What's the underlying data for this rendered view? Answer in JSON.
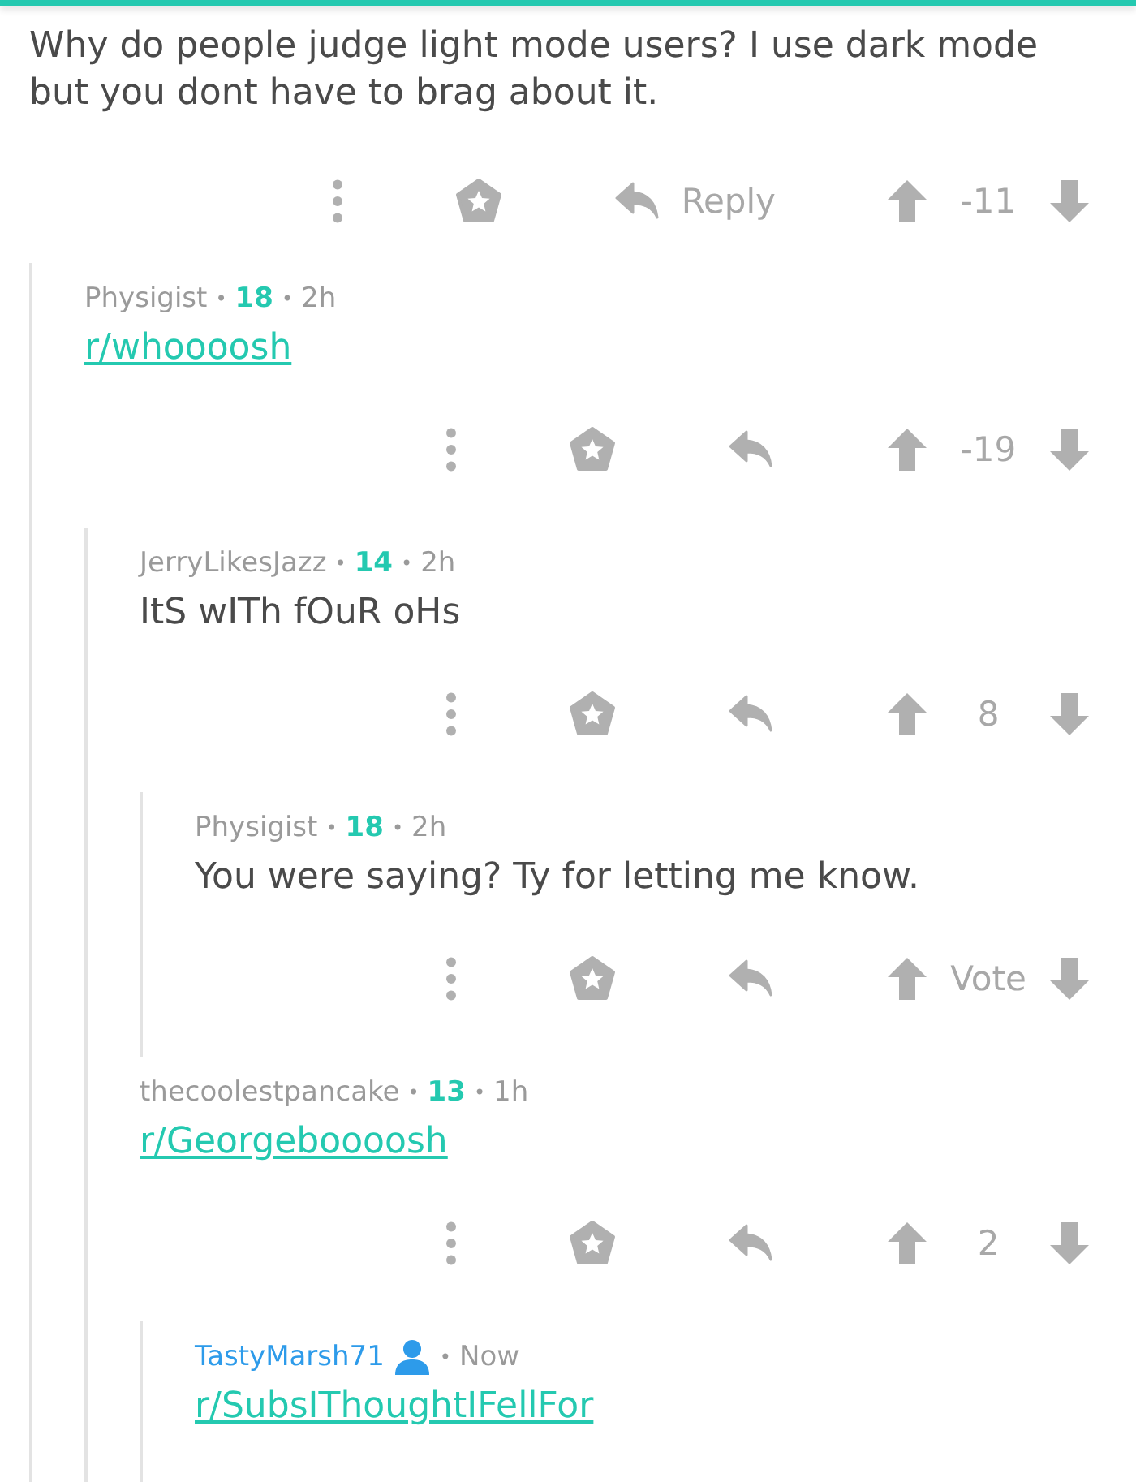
{
  "comments": [
    {
      "body": {
        "kind": "text",
        "text": "Why do people judge light mode users? I use dark mode but you dont have to brag about it."
      },
      "actions": {
        "reply_label": "Reply",
        "score": "-11"
      },
      "children": [
        {
          "author": "Physigist",
          "op": false,
          "meta": [
            {
              "kind": "sep",
              "text": "•"
            },
            {
              "kind": "karma",
              "text": "18"
            },
            {
              "kind": "sep",
              "text": "•"
            },
            {
              "kind": "time",
              "text": "2h"
            }
          ],
          "body": {
            "kind": "link",
            "text": "r/whoooosh"
          },
          "actions": {
            "score": "-19"
          },
          "children": [
            {
              "author": "JerryLikesJazz",
              "op": false,
              "meta": [
                {
                  "kind": "sep",
                  "text": "•"
                },
                {
                  "kind": "karma",
                  "text": "14"
                },
                {
                  "kind": "sep",
                  "text": "•"
                },
                {
                  "kind": "time",
                  "text": "2h"
                }
              ],
              "body": {
                "kind": "text",
                "text": "ItS wITh fOuR oHs"
              },
              "actions": {
                "score": "8"
              },
              "children": [
                {
                  "author": "Physigist",
                  "op": false,
                  "meta": [
                    {
                      "kind": "sep",
                      "text": "•"
                    },
                    {
                      "kind": "karma",
                      "text": "18"
                    },
                    {
                      "kind": "sep",
                      "text": "•"
                    },
                    {
                      "kind": "time",
                      "text": "2h"
                    }
                  ],
                  "body": {
                    "kind": "text",
                    "text": "You were saying? Ty for letting me know."
                  },
                  "actions": {
                    "score": "Vote"
                  }
                }
              ]
            },
            {
              "author": "thecoolestpancake",
              "op": false,
              "meta": [
                {
                  "kind": "sep",
                  "text": "•"
                },
                {
                  "kind": "karma",
                  "text": "13"
                },
                {
                  "kind": "sep",
                  "text": "•"
                },
                {
                  "kind": "time",
                  "text": "1h"
                }
              ],
              "body": {
                "kind": "link",
                "text": "r/Georgeboooosh"
              },
              "actions": {
                "score": "2"
              },
              "children": [
                {
                  "author": "TastyMarsh71",
                  "op": true,
                  "meta": [
                    {
                      "kind": "sep",
                      "text": "•"
                    },
                    {
                      "kind": "time",
                      "text": "Now"
                    }
                  ],
                  "body": {
                    "kind": "link",
                    "text": "r/SubsIThoughtIFellFor"
                  }
                }
              ]
            }
          ]
        }
      ]
    }
  ]
}
